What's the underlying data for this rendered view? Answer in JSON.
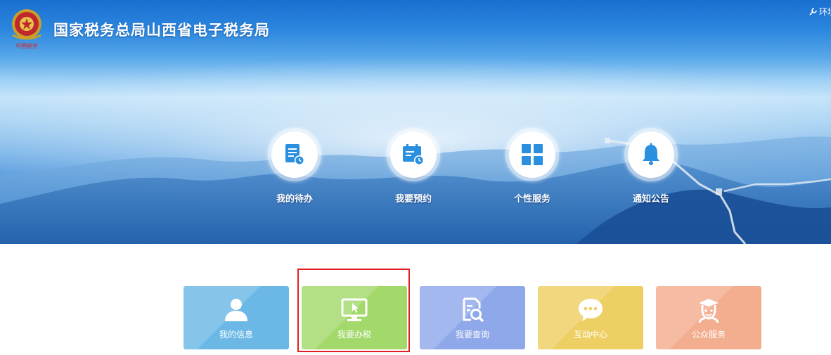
{
  "header": {
    "title": "国家税务总局山西省电子税务局",
    "env_link": "环境",
    "emblem_icon": "tax-emblem-icon",
    "emblem_caption": "中国税务"
  },
  "circle_nav": [
    {
      "label": "我的待办",
      "icon": "todo-icon"
    },
    {
      "label": "我要预约",
      "icon": "calendar-icon"
    },
    {
      "label": "个性服务",
      "icon": "grid-icon"
    },
    {
      "label": "通知公告",
      "icon": "bell-icon"
    }
  ],
  "tiles": [
    {
      "label": "我的信息",
      "icon": "user-icon",
      "color": "#6bb8e6"
    },
    {
      "label": "我要办税",
      "icon": "monitor-icon",
      "color": "#a2d96a",
      "highlighted": true
    },
    {
      "label": "我要查询",
      "icon": "search-document-icon",
      "color": "#8fa8ea"
    },
    {
      "label": "互动中心",
      "icon": "chat-icon",
      "color": "#eecf63"
    },
    {
      "label": "公众服务",
      "icon": "service-person-icon",
      "color": "#f3ad8f"
    }
  ],
  "colors": {
    "banner_blue": "#2a86de",
    "icon_blue": "#2b8fe0",
    "highlight_red": "#e02020"
  }
}
